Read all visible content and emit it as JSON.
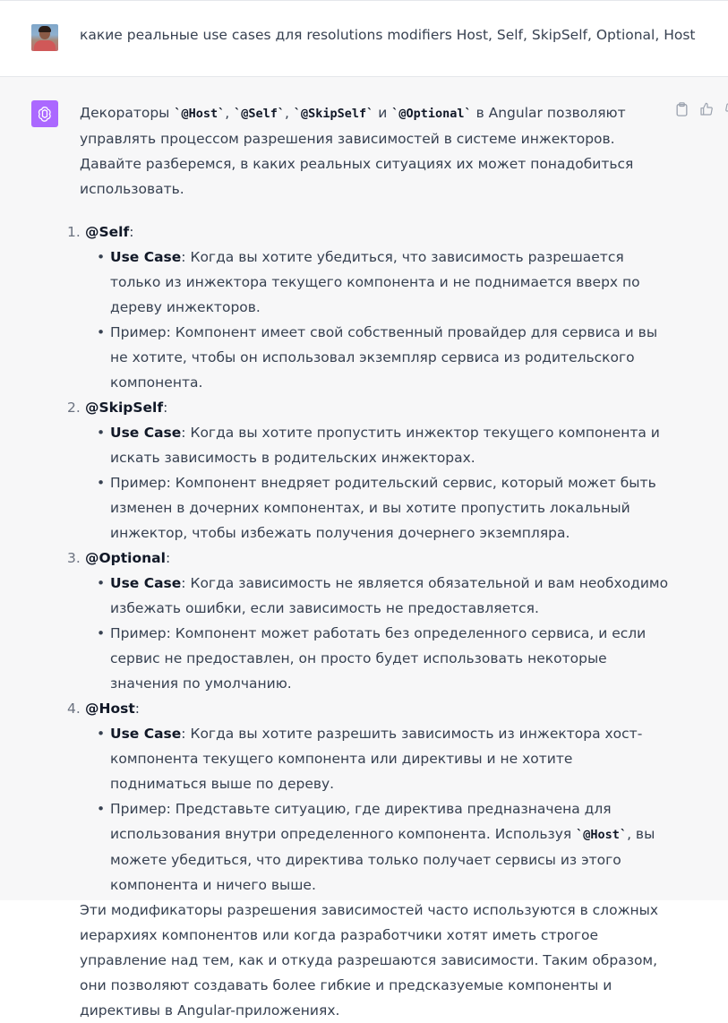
{
  "user_message": {
    "text": "какие реальные use cases для resolutions modifiers Host, Self, SkipSelf, Optional, Host"
  },
  "assistant_message": {
    "intro": [
      {
        "t": "text",
        "v": "Декораторы "
      },
      {
        "t": "code",
        "v": "`@Host`"
      },
      {
        "t": "text",
        "v": ", "
      },
      {
        "t": "code",
        "v": "`@Self`"
      },
      {
        "t": "text",
        "v": ", "
      },
      {
        "t": "code",
        "v": "`@SkipSelf`"
      },
      {
        "t": "text",
        "v": " и "
      },
      {
        "t": "code",
        "v": "`@Optional`"
      },
      {
        "t": "text",
        "v": " в Angular позволяют управлять процессом разрешения зависимостей в системе инжекторов. Давайте разберемся, в каких реальных ситуациях их может понадобиться использовать."
      }
    ],
    "items": [
      {
        "number": "1.",
        "title": "@Self",
        "bullets": [
          {
            "label": "Use Case",
            "text": ": Когда вы хотите убедиться, что зависимость разрешается только из инжектора текущего компонента и не поднимается вверх по дереву инжекторов."
          },
          {
            "label": "",
            "text": "Пример: Компонент имеет свой собственный провайдер для сервиса и вы не хотите, чтобы он использовал экземпляр сервиса из родительского компонента."
          }
        ]
      },
      {
        "number": "2.",
        "title": "@SkipSelf",
        "bullets": [
          {
            "label": "Use Case",
            "text": ": Когда вы хотите пропустить инжектор текущего компонента и искать зависимость в родительских инжекторах."
          },
          {
            "label": "",
            "text": "Пример: Компонент внедряет родительский сервис, который может быть изменен в дочерних компонентах, и вы хотите пропустить локальный инжектор, чтобы избежать получения дочернего экземпляра."
          }
        ]
      },
      {
        "number": "3.",
        "title": "@Optional",
        "bullets": [
          {
            "label": "Use Case",
            "text": ": Когда зависимость не является обязательной и вам необходимо избежать ошибки, если зависимость не предоставляется."
          },
          {
            "label": "",
            "text": "Пример: Компонент может работать без определенного сервиса, и если сервис не предоставлен, он просто будет использовать некоторые значения по умолчанию."
          }
        ]
      },
      {
        "number": "4.",
        "title": "@Host",
        "bullets": [
          {
            "label": "Use Case",
            "text": ": Когда вы хотите разрешить зависимость из инжектора хост-компонента текущего компонента или директивы и не хотите подниматься выше по дереву."
          },
          {
            "label": "",
            "text": "Пример: Представьте ситуацию, где директива предназначена для использования внутри определенного компонента. Используя ",
            "code": "`@Host`",
            "after": ", вы можете убедиться, что директива только получает сервисы из этого компонента и ничего выше."
          }
        ]
      }
    ],
    "closing": "Эти модификаторы разрешения зависимостей часто используются в сложных иерархиях компонентов или когда разработчики хотят иметь строгое управление над тем, как и откуда разрешаются зависимости. Таким образом, они позволяют создавать более гибкие и предсказуемые компоненты и директивы в Angular-приложениях."
  },
  "icons": {
    "user_avatar": "user-photo-avatar",
    "assistant_avatar": "openai-logo-icon",
    "copy": "clipboard-icon",
    "like": "thumbs-up-icon",
    "dislike": "thumbs-down-icon"
  },
  "colors": {
    "assistant_avatar_bg": "#ab68ff",
    "assistant_row_bg": "#f7f7f8",
    "text": "#374151"
  }
}
